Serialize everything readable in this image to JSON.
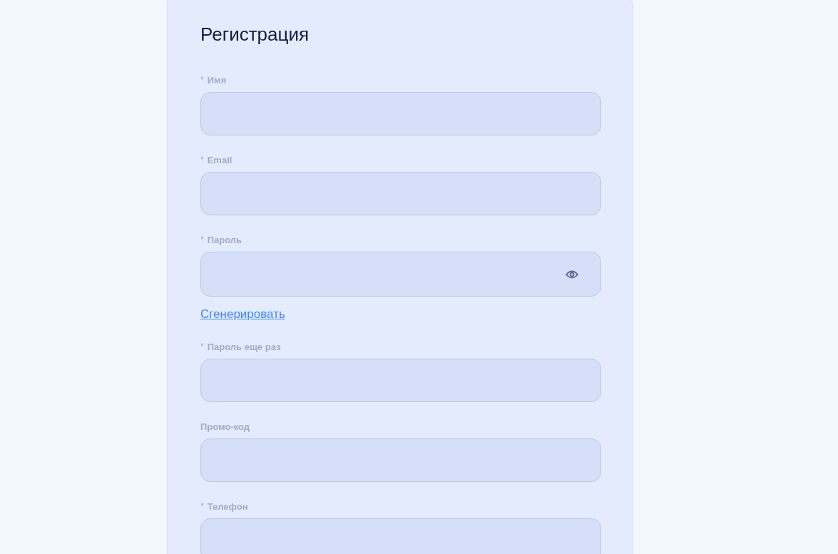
{
  "form": {
    "title": "Регистрация",
    "fields": [
      {
        "kind": "text",
        "required_mark": "*",
        "label": "Имя"
      },
      {
        "kind": "text",
        "required_mark": "*",
        "label": "Email"
      },
      {
        "kind": "password",
        "required_mark": "*",
        "label": "Пароль",
        "link": "Сгенерировать"
      },
      {
        "kind": "text",
        "required_mark": "*",
        "label": "Пароль еще раз"
      },
      {
        "kind": "text",
        "label": "Промо-код"
      },
      {
        "kind": "text",
        "required_mark": "*",
        "label": "Телефон"
      }
    ]
  }
}
